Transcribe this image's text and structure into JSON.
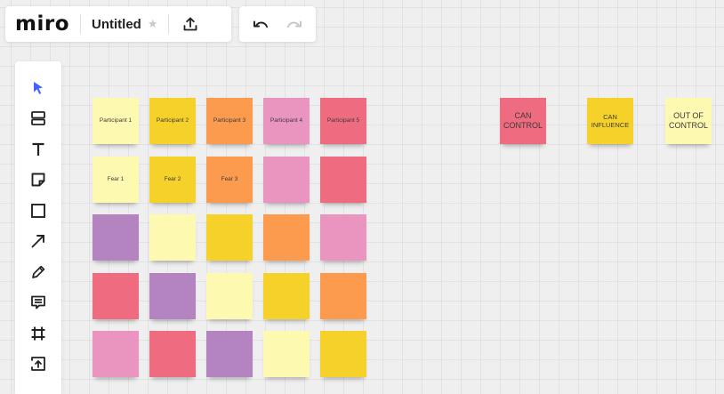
{
  "app": {
    "logo": "miro",
    "board_name": "Untitled"
  },
  "header_icons": [
    "star-icon",
    "share-upload-icon",
    "undo-icon",
    "redo-icon"
  ],
  "toolbar_tools": [
    "select",
    "templates",
    "text",
    "sticky-note",
    "shape",
    "connection-line",
    "pen",
    "comment",
    "frame",
    "upload"
  ],
  "colors": {
    "light_yellow": "#fef9b0",
    "yellow": "#f5d12a",
    "orange": "#fc9b4e",
    "pink": "#ea94c0",
    "red": "#ef6c80",
    "purple": "#b384bf",
    "accent": "#4262ff"
  },
  "participants": [
    {
      "label": "Participant 1",
      "color": "light_yellow"
    },
    {
      "label": "Participant 2",
      "color": "yellow"
    },
    {
      "label": "Participant 3",
      "color": "orange"
    },
    {
      "label": "Participant 4",
      "color": "pink"
    },
    {
      "label": "Participant 5",
      "color": "red"
    }
  ],
  "sticky_rows": [
    [
      {
        "label": "Fear 1",
        "color": "light_yellow"
      },
      {
        "label": "Fear 2",
        "color": "yellow"
      },
      {
        "label": "Fear  3",
        "color": "orange"
      },
      {
        "label": "",
        "color": "pink"
      },
      {
        "label": "",
        "color": "red"
      }
    ],
    [
      {
        "label": "",
        "color": "purple"
      },
      {
        "label": "",
        "color": "light_yellow"
      },
      {
        "label": "",
        "color": "yellow"
      },
      {
        "label": "",
        "color": "orange"
      },
      {
        "label": "",
        "color": "pink"
      }
    ],
    [
      {
        "label": "",
        "color": "red"
      },
      {
        "label": "",
        "color": "purple"
      },
      {
        "label": "",
        "color": "light_yellow"
      },
      {
        "label": "",
        "color": "yellow"
      },
      {
        "label": "",
        "color": "orange"
      }
    ],
    [
      {
        "label": "",
        "color": "pink"
      },
      {
        "label": "",
        "color": "red"
      },
      {
        "label": "",
        "color": "purple"
      },
      {
        "label": "",
        "color": "light_yellow"
      },
      {
        "label": "",
        "color": "yellow"
      }
    ]
  ],
  "categories": [
    {
      "label": "CAN CONTROL",
      "color": "red"
    },
    {
      "label": "CAN INFLUENCE",
      "color": "yellow"
    },
    {
      "label": "OUT OF CONTROL",
      "color": "light_yellow"
    }
  ]
}
